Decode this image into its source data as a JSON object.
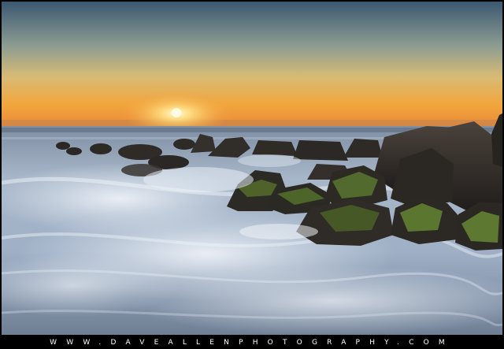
{
  "image": {
    "scene": "seascape-sunrise",
    "colors": {
      "sky_top": "#3f5d76",
      "sky_mid": "#c8b27a",
      "horizon_glow": "#f2a63a",
      "sun": "#fff6c8",
      "sea": "#6f8aa8",
      "rock": "#2f2b28",
      "moss": "#5b7a2b",
      "border": "#000000"
    }
  },
  "footer": {
    "watermark": "WWW.DAVEALLENPHOTOGRAPHY.COM"
  }
}
